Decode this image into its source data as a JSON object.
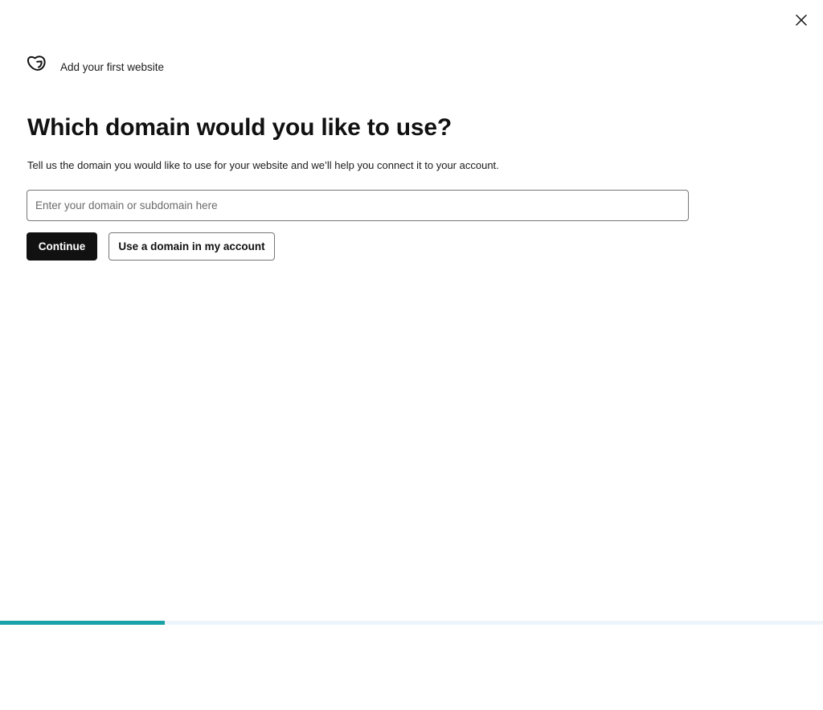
{
  "header": {
    "brand_text": "Add your first website",
    "logo_icon": "godaddy-logo-icon",
    "close_icon": "close-icon"
  },
  "main": {
    "title": "Which domain would you like to use?",
    "subtitle": "Tell us the domain you would like to use for your website and we’ll help you connect it to your account.",
    "domain_input": {
      "value": "",
      "placeholder": "Enter your domain or subdomain here"
    },
    "continue_label": "Continue",
    "use_domain_label": "Use a domain in my account"
  },
  "progress": {
    "fraction": 0.2,
    "fill_color": "#1ba1a8",
    "track_color": "#eef5fa"
  }
}
